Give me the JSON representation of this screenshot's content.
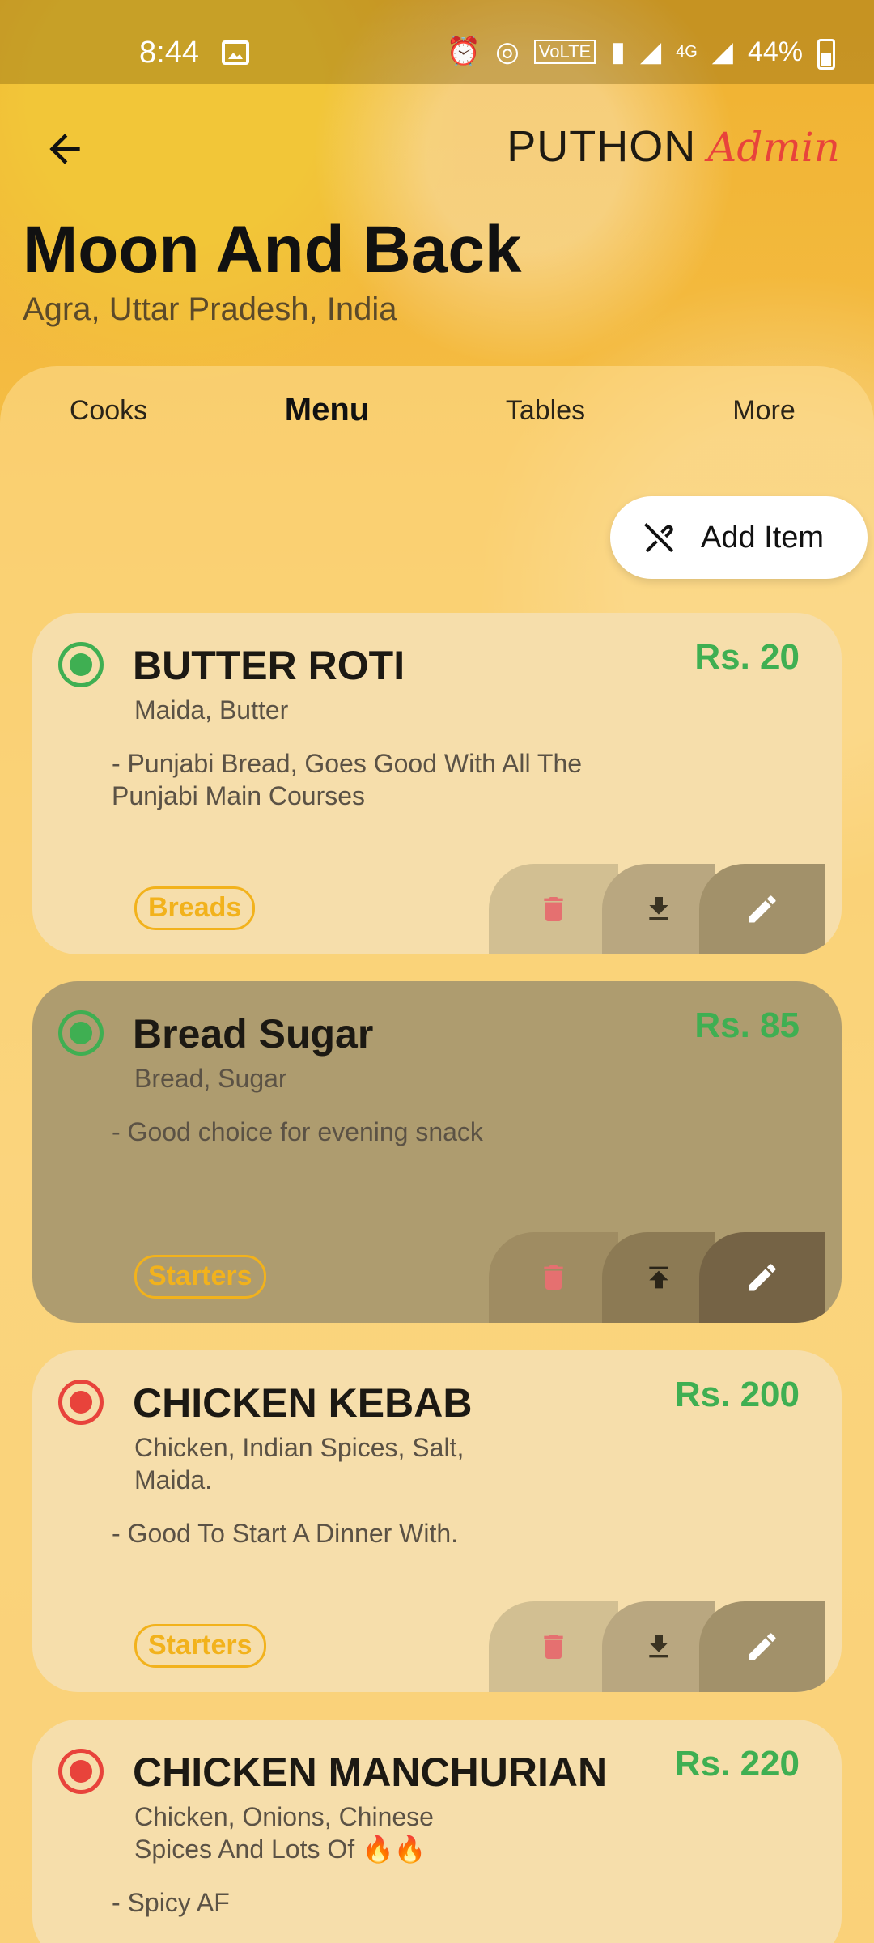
{
  "status_bar": {
    "time": "8:44",
    "battery": "44%",
    "network": "4G"
  },
  "header": {
    "brand_name": "PUTHON",
    "brand_role": "Admin",
    "restaurant_name": "Moon And Back",
    "location": "Agra, Uttar Pradesh, India"
  },
  "tabs": [
    {
      "label": "Cooks"
    },
    {
      "label": "Menu",
      "active": true
    },
    {
      "label": "Tables"
    },
    {
      "label": "More"
    }
  ],
  "add_item": {
    "label": "Add Item"
  },
  "menu_items": [
    {
      "name": "BUTTER ROTI",
      "price": "Rs. 20",
      "ingredients": "Maida, Butter",
      "description": "-  Punjabi Bread, Goes Good With All The Punjabi Main Courses",
      "category": "Breads",
      "type": "veg",
      "state": "active"
    },
    {
      "name": "Bread Sugar",
      "price": "Rs. 85",
      "ingredients": "Bread, Sugar",
      "description": "-  Good choice for evening snack",
      "category": "Starters",
      "type": "veg",
      "state": "hidden"
    },
    {
      "name": "CHICKEN KEBAB",
      "price": "Rs. 200",
      "ingredients": "Chicken, Indian Spices, Salt, Maida.",
      "description": "-  Good To Start A Dinner With.",
      "category": "Starters",
      "type": "nonveg",
      "state": "active"
    },
    {
      "name": "CHICKEN MANCHURIAN",
      "price": "Rs. 220",
      "ingredients": "Chicken, Onions, Chinese Spices And Lots Of 🔥🔥",
      "description": "-  Spicy AF",
      "category": "",
      "type": "nonveg",
      "state": "active"
    }
  ],
  "colors": {
    "veg": "#3faf52",
    "nonveg": "#e8433b",
    "price": "#3faf52",
    "category": "#f2b21c",
    "accent": "#e8433b"
  }
}
